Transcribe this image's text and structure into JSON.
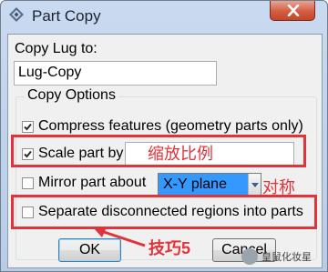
{
  "window": {
    "title": "Part Copy",
    "icon": "abaqus-logo-icon",
    "close_icon": "close-icon"
  },
  "copy_to": {
    "label": "Copy Lug to:",
    "value": "Lug-Copy"
  },
  "options": {
    "group_label": "Copy Options",
    "compress": {
      "label": "Compress features (geometry parts only)",
      "checked": true
    },
    "scale": {
      "label": "Scale part by",
      "checked": true,
      "value": ""
    },
    "mirror": {
      "label": "Mirror part about",
      "checked": false,
      "plane": "X-Y plane"
    },
    "separate": {
      "label": "Separate disconnected regions into parts",
      "checked": false
    }
  },
  "buttons": {
    "ok": "OK",
    "cancel": "Cancel"
  },
  "annotations": {
    "scale_note": "缩放比例",
    "mirror_note": "对称",
    "tip_note": "技巧5",
    "color": "#e0333a"
  },
  "watermark": "皇鼠化妆星"
}
